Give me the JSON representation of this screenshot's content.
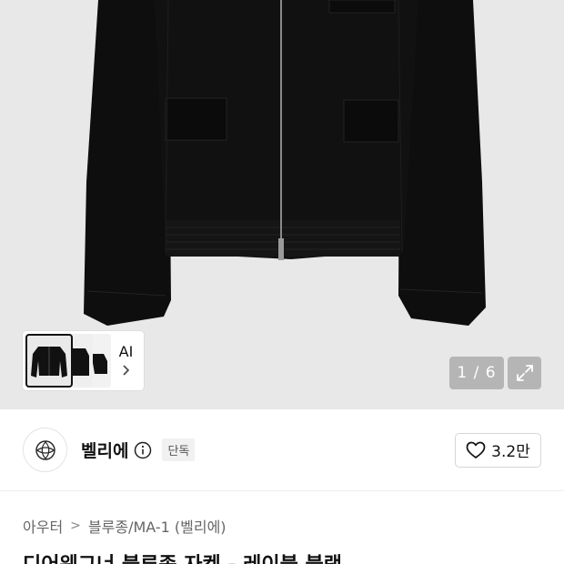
{
  "gallery": {
    "thumbnail_ai_label": "AI",
    "counter": "1 / 6",
    "icons": {
      "expand": "expand-icon",
      "thumb_next": "chevron-right-icon"
    }
  },
  "brand": {
    "name": "벨리에",
    "badge": "단독",
    "likes": "3.2만",
    "icons": {
      "logo": "brand-logo-icon",
      "info": "info-icon",
      "like": "heart-icon"
    }
  },
  "breadcrumb": {
    "items": [
      "아우터",
      "블루종/MA-1 (벨리에)"
    ],
    "separator": ">"
  },
  "product": {
    "title": "디어웨그너 블루종 자켓 - 레이블 블랙"
  },
  "colors": {
    "background": "#e8e8e8",
    "jacket": "#0e0e0e",
    "text_primary": "#111111",
    "text_secondary": "#666666"
  }
}
